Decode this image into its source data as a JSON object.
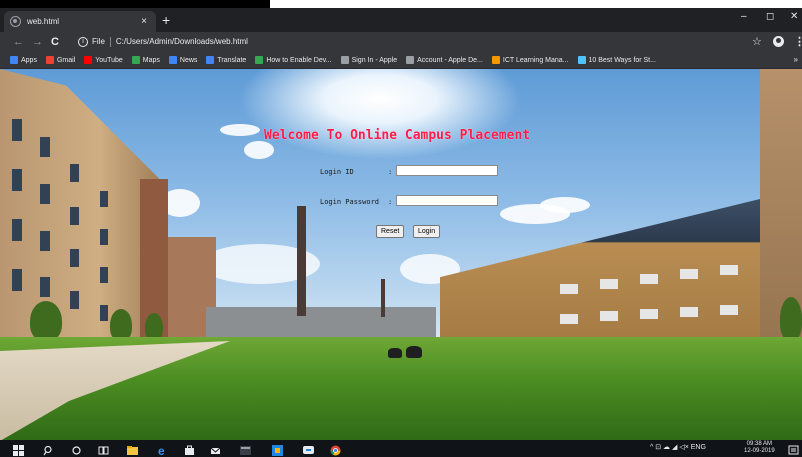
{
  "browser": {
    "tab_title": "web.html",
    "tab_close": "×",
    "new_tab": "+",
    "window_minimize": "–",
    "window_restore": "◻",
    "window_close": "✕",
    "url_label": "File",
    "url": "C:/Users/Admin/Downloads/web.html",
    "bookmarks": [
      {
        "label": "Apps",
        "icon": "apps-grid-icon",
        "color": "#4285f4"
      },
      {
        "label": "Gmail",
        "icon": "gmail-icon",
        "color": "#ea4335"
      },
      {
        "label": "YouTube",
        "icon": "youtube-icon",
        "color": "#ff0000"
      },
      {
        "label": "Maps",
        "icon": "maps-icon",
        "color": "#34a853"
      },
      {
        "label": "News",
        "icon": "news-icon",
        "color": "#4285f4"
      },
      {
        "label": "Translate",
        "icon": "translate-icon",
        "color": "#4285f4"
      },
      {
        "label": "How to Enable Dev...",
        "icon": "dev-icon",
        "color": "#34a853"
      },
      {
        "label": "Sign In - Apple",
        "icon": "apple-icon",
        "color": "#9aa0a6"
      },
      {
        "label": "Account - Apple De...",
        "icon": "apple-icon",
        "color": "#9aa0a6"
      },
      {
        "label": "ICT Learning Mana...",
        "icon": "ict-icon",
        "color": "#f29900"
      },
      {
        "label": "10 Best Ways for St...",
        "icon": "star-icon",
        "color": "#4fc3f7"
      }
    ],
    "bookmarks_more": "»"
  },
  "page": {
    "welcome_title": "Welcome To Online Campus Placement",
    "login_id_label": "Login ID",
    "login_password_label": "Login Password",
    "colon": ":",
    "login_id_value": "",
    "login_password_value": "",
    "reset_label": "Reset",
    "login_label": "Login"
  },
  "taskbar": {
    "tray_text": "^ ⊡ ☁ ◢ ◁× ENG",
    "time": "09:38 AM",
    "date": "12-09-2019"
  },
  "colors": {
    "welcome_title": "#ff1a4a",
    "chrome_dark": "#35363a",
    "taskbar": "#101318"
  }
}
